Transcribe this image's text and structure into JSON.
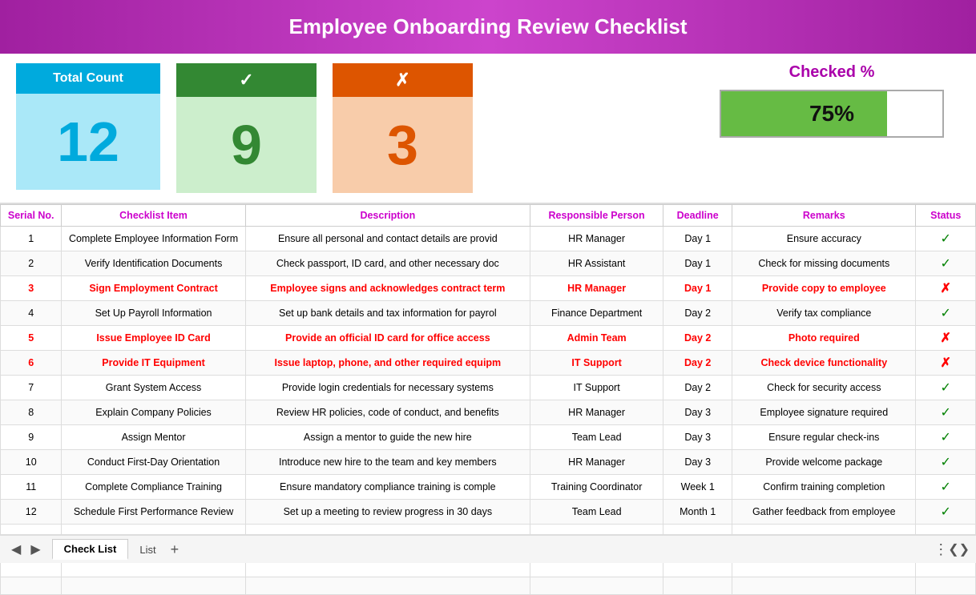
{
  "header": {
    "title": "Employee Onboarding Review Checklist"
  },
  "stats": {
    "total_count_label": "Total Count",
    "total_count_value": "12",
    "checked_label": "✓",
    "checked_value": "9",
    "unchecked_label": "✗",
    "unchecked_value": "3",
    "percent_label": "Checked %",
    "percent_value": "75%",
    "percent_number": 75
  },
  "table": {
    "columns": [
      "Serial No.",
      "Checklist Item",
      "Description",
      "Responsible Person",
      "Deadline",
      "Remarks",
      "Status"
    ],
    "rows": [
      {
        "serial": "1",
        "item": "Complete Employee Information Form",
        "description": "Ensure all personal and contact details are provid",
        "person": "HR Manager",
        "deadline": "Day 1",
        "remarks": "Ensure accuracy",
        "status": "check",
        "highlight": false
      },
      {
        "serial": "2",
        "item": "Verify Identification Documents",
        "description": "Check passport, ID card, and other necessary doc",
        "person": "HR Assistant",
        "deadline": "Day 1",
        "remarks": "Check for missing documents",
        "status": "check",
        "highlight": false
      },
      {
        "serial": "3",
        "item": "Sign Employment Contract",
        "description": "Employee signs and acknowledges contract term",
        "person": "HR Manager",
        "deadline": "Day 1",
        "remarks": "Provide copy to employee",
        "status": "cross",
        "highlight": true
      },
      {
        "serial": "4",
        "item": "Set Up Payroll Information",
        "description": "Set up bank details and tax information for payrol",
        "person": "Finance Department",
        "deadline": "Day 2",
        "remarks": "Verify tax compliance",
        "status": "check",
        "highlight": false
      },
      {
        "serial": "5",
        "item": "Issue Employee ID Card",
        "description": "Provide an official ID card for office access",
        "person": "Admin Team",
        "deadline": "Day 2",
        "remarks": "Photo required",
        "status": "cross",
        "highlight": true
      },
      {
        "serial": "6",
        "item": "Provide IT Equipment",
        "description": "Issue laptop, phone, and other required equipm",
        "person": "IT Support",
        "deadline": "Day 2",
        "remarks": "Check device functionality",
        "status": "cross",
        "highlight": true
      },
      {
        "serial": "7",
        "item": "Grant System Access",
        "description": "Provide login credentials for necessary systems",
        "person": "IT Support",
        "deadline": "Day 2",
        "remarks": "Check for security access",
        "status": "check",
        "highlight": false
      },
      {
        "serial": "8",
        "item": "Explain Company Policies",
        "description": "Review HR policies, code of conduct, and benefits",
        "person": "HR Manager",
        "deadline": "Day 3",
        "remarks": "Employee signature required",
        "status": "check",
        "highlight": false
      },
      {
        "serial": "9",
        "item": "Assign Mentor",
        "description": "Assign a mentor to guide the new hire",
        "person": "Team Lead",
        "deadline": "Day 3",
        "remarks": "Ensure regular check-ins",
        "status": "check",
        "highlight": false
      },
      {
        "serial": "10",
        "item": "Conduct First-Day Orientation",
        "description": "Introduce new hire to the team and key members",
        "person": "HR Manager",
        "deadline": "Day 3",
        "remarks": "Provide welcome package",
        "status": "check",
        "highlight": false
      },
      {
        "serial": "11",
        "item": "Complete Compliance Training",
        "description": "Ensure mandatory compliance training is comple",
        "person": "Training Coordinator",
        "deadline": "Week 1",
        "remarks": "Confirm training completion",
        "status": "check",
        "highlight": false
      },
      {
        "serial": "12",
        "item": "Schedule First Performance Review",
        "description": "Set up a meeting to review progress in 30 days",
        "person": "Team Lead",
        "deadline": "Month 1",
        "remarks": "Gather feedback from employee",
        "status": "check",
        "highlight": false
      }
    ]
  },
  "bottom_tabs": {
    "active": "Check List",
    "inactive": "List",
    "add": "+"
  }
}
